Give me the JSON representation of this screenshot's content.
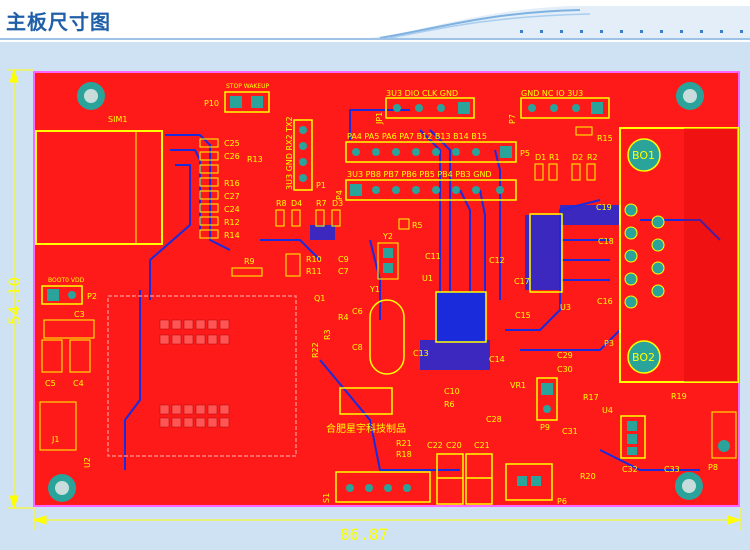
{
  "header": {
    "title": "主板尺寸图"
  },
  "dimensions": {
    "width": "86.87",
    "height": "54.10"
  },
  "colors": {
    "pcb": "#ff1a1a",
    "silk": "#ffff00",
    "trace": "#1a2bdc",
    "pad": "#2aa39a",
    "frame": "#ff66ff"
  },
  "board": {
    "company": "合肥星宇科技制品",
    "sim_label": "SIM1",
    "labels": {
      "P10": "P10",
      "P10_pins": "STOP WAKEUP",
      "P1": "P1",
      "P1_pins": "3U3 GND RX2 TX2",
      "JP1": "JP1",
      "JP1_pins": "3U3 DIO CLK GND",
      "P7": "P7",
      "P7_pins": "GND NC IO 3U3",
      "P5": "P5",
      "P5_top": "PA4 PA5 PA6 PA7 B12 B13 B14 B15",
      "P5_bottom": "3U3 PB8 PB7 PB6 PB5 PB4 PB3 GND",
      "P4": "P4",
      "P2": "P2",
      "P2_pins": "BOOT0 VDD",
      "P3": "P3",
      "P6": "P6",
      "P8": "P8",
      "P9": "P9",
      "J1": "J1",
      "U2": "U2",
      "S1": "S1",
      "BO1": "BO1",
      "BO2": "BO2",
      "U1": "U1",
      "U3": "U3",
      "U4": "U4",
      "Y1": "Y1",
      "Y2": "Y2",
      "Q1": "Q1",
      "VR1": "VR1",
      "D1": "D1",
      "R1": "R1",
      "D2": "D2",
      "R2": "R2",
      "R15": "R15",
      "R17": "R17",
      "R19": "R19",
      "R20": "R20",
      "R8": "R8",
      "D4": "D4",
      "R7": "R7",
      "D3": "D3",
      "R5": "R5",
      "R9": "R9",
      "R10": "R10",
      "R11": "R11",
      "R12": "R12",
      "R13": "R13",
      "R14": "R14",
      "R16": "R16",
      "R3": "R3",
      "R4": "R4",
      "R6": "R6",
      "R18": "R18",
      "R21": "R21",
      "R22": "R22",
      "C3": "C3",
      "C4": "C4",
      "C5": "C5",
      "C6": "C6",
      "C7": "C7",
      "C8": "C8",
      "C9": "C9",
      "C10": "C10",
      "C11": "C11",
      "C12": "C12",
      "C13": "C13",
      "C14": "C14",
      "C15": "C15",
      "C16": "C16",
      "C17": "C17",
      "C18": "C18",
      "C19": "C19",
      "C20": "C20",
      "C21": "C21",
      "C22": "C22",
      "C24": "C24",
      "C25": "C25",
      "C26": "C26",
      "C27": "C27",
      "C28": "C28",
      "C29": "C29",
      "C30": "C30",
      "C31": "C31",
      "C32": "C32",
      "C33": "C33"
    }
  }
}
